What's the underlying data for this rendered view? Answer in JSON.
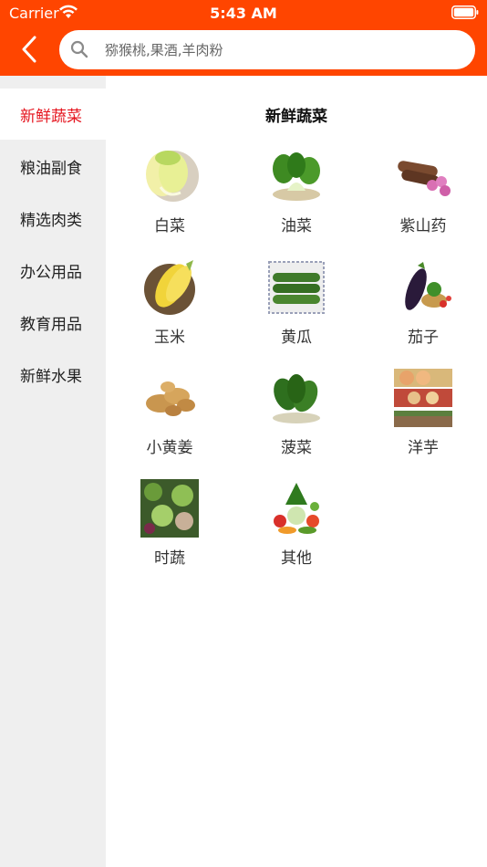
{
  "status_bar": {
    "carrier": "Carrier",
    "time": "5:43 AM"
  },
  "header": {
    "back_icon": "chevron-left-icon",
    "search": {
      "placeholder": "猕猴桃,果酒,羊肉粉",
      "icon": "search-icon"
    }
  },
  "colors": {
    "brand": "#FF4500",
    "active_text": "#E5141E",
    "sidebar_bg": "#EFEFEF"
  },
  "sidebar": {
    "items": [
      {
        "label": "新鲜蔬菜",
        "active": true
      },
      {
        "label": "粮油副食",
        "active": false
      },
      {
        "label": "精选肉类",
        "active": false
      },
      {
        "label": "办公用品",
        "active": false
      },
      {
        "label": "教育用品",
        "active": false
      },
      {
        "label": "新鲜水果",
        "active": false
      }
    ]
  },
  "main": {
    "title": "新鲜蔬菜",
    "items": [
      {
        "label": "白菜",
        "icon": "chinese-cabbage-image"
      },
      {
        "label": "油菜",
        "icon": "bok-choy-image"
      },
      {
        "label": "紫山药",
        "icon": "purple-yam-image"
      },
      {
        "label": "玉米",
        "icon": "corn-image"
      },
      {
        "label": "黄瓜",
        "icon": "cucumber-image"
      },
      {
        "label": "茄子",
        "icon": "eggplant-image"
      },
      {
        "label": "小黄姜",
        "icon": "ginger-image"
      },
      {
        "label": "菠菜",
        "icon": "spinach-image"
      },
      {
        "label": "洋芋",
        "icon": "potato-image"
      },
      {
        "label": "时蔬",
        "icon": "seasonal-vegetables-image"
      },
      {
        "label": "其他",
        "icon": "other-vegetables-image"
      }
    ]
  }
}
